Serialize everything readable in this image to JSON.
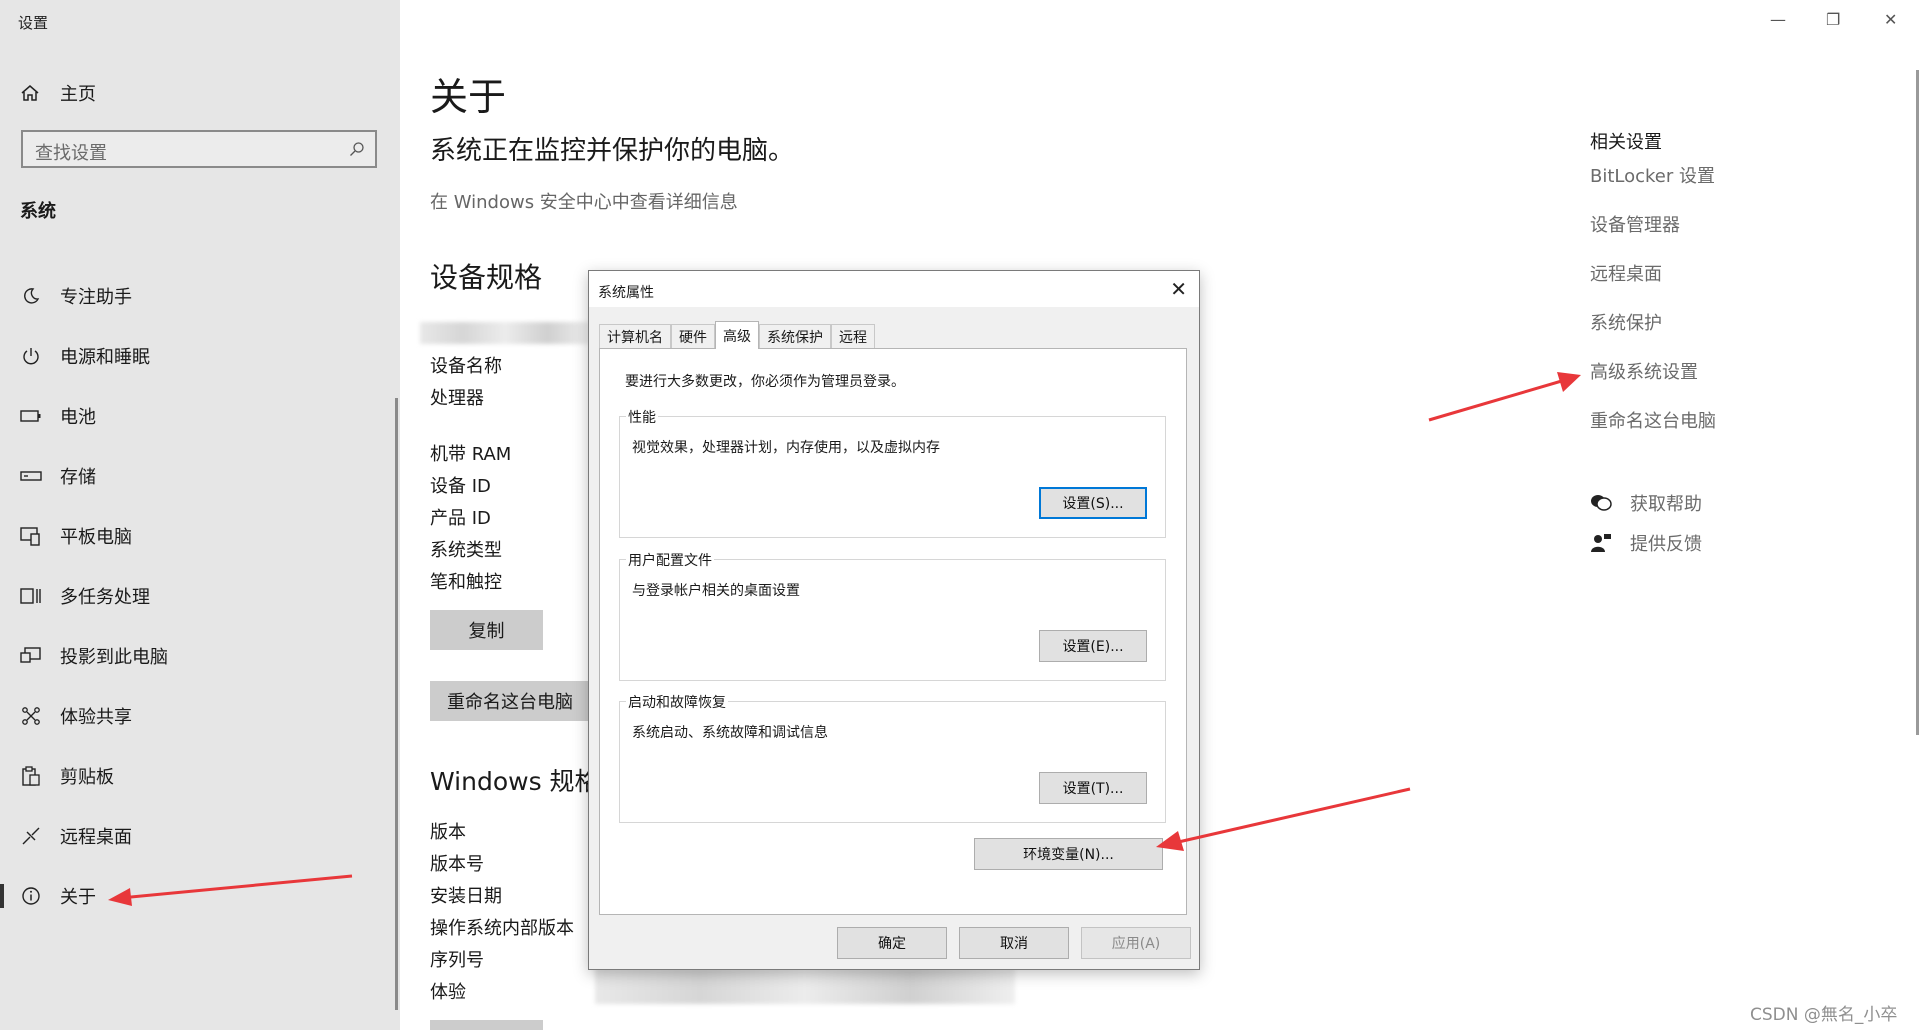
{
  "window": {
    "title": "设置"
  },
  "sidebar": {
    "home_label": "主页",
    "search_placeholder": "查找设置",
    "section_label": "系统",
    "items": [
      {
        "label": "专注助手",
        "icon": "moon-icon"
      },
      {
        "label": "电源和睡眠",
        "icon": "power-icon"
      },
      {
        "label": "电池",
        "icon": "battery-icon"
      },
      {
        "label": "存储",
        "icon": "storage-icon"
      },
      {
        "label": "平板电脑",
        "icon": "tablet-icon"
      },
      {
        "label": "多任务处理",
        "icon": "multitask-icon"
      },
      {
        "label": "投影到此电脑",
        "icon": "project-icon"
      },
      {
        "label": "体验共享",
        "icon": "share-icon"
      },
      {
        "label": "剪贴板",
        "icon": "clipboard-icon"
      },
      {
        "label": "远程桌面",
        "icon": "remote-icon"
      },
      {
        "label": "关于",
        "icon": "info-icon",
        "selected": true
      }
    ]
  },
  "main": {
    "title": "关于",
    "subtitle": "系统正在监控并保护你的电脑。",
    "security_link": "在 Windows 安全中心中查看详细信息",
    "device_specs_heading": "设备规格",
    "device_spec_labels": [
      "设备名称",
      "处理器",
      "机带 RAM",
      "设备 ID",
      "产品 ID",
      "系统类型",
      "笔和触控"
    ],
    "copy_button": "复制",
    "rename_button": "重命名这台电脑",
    "windows_specs_heading": "Windows 规格",
    "windows_spec_labels": [
      "版本",
      "版本号",
      "安装日期",
      "操作系统内部版本",
      "序列号",
      "体验"
    ]
  },
  "related": {
    "title": "相关设置",
    "links": [
      "BitLocker 设置",
      "设备管理器",
      "远程桌面",
      "系统保护",
      "高级系统设置",
      "重命名这台电脑"
    ],
    "help": "获取帮助",
    "feedback": "提供反馈"
  },
  "dialog": {
    "title": "系统属性",
    "tabs": [
      "计算机名",
      "硬件",
      "高级",
      "系统保护",
      "远程"
    ],
    "active_tab": "高级",
    "admin_note": "要进行大多数更改，你必须作为管理员登录。",
    "groups": [
      {
        "legend": "性能",
        "desc": "视觉效果，处理器计划，内存使用，以及虚拟内存",
        "button": "设置(S)..."
      },
      {
        "legend": "用户配置文件",
        "desc": "与登录帐户相关的桌面设置",
        "button": "设置(E)..."
      },
      {
        "legend": "启动和故障恢复",
        "desc": "系统启动、系统故障和调试信息",
        "button": "设置(T)..."
      }
    ],
    "env_button": "环境变量(N)...",
    "ok": "确定",
    "cancel": "取消",
    "apply": "应用(A)"
  },
  "colors": {
    "annotation_arrow": "#e8373a",
    "focus_border": "#0078d7"
  },
  "watermark": "CSDN @無名_小卒"
}
